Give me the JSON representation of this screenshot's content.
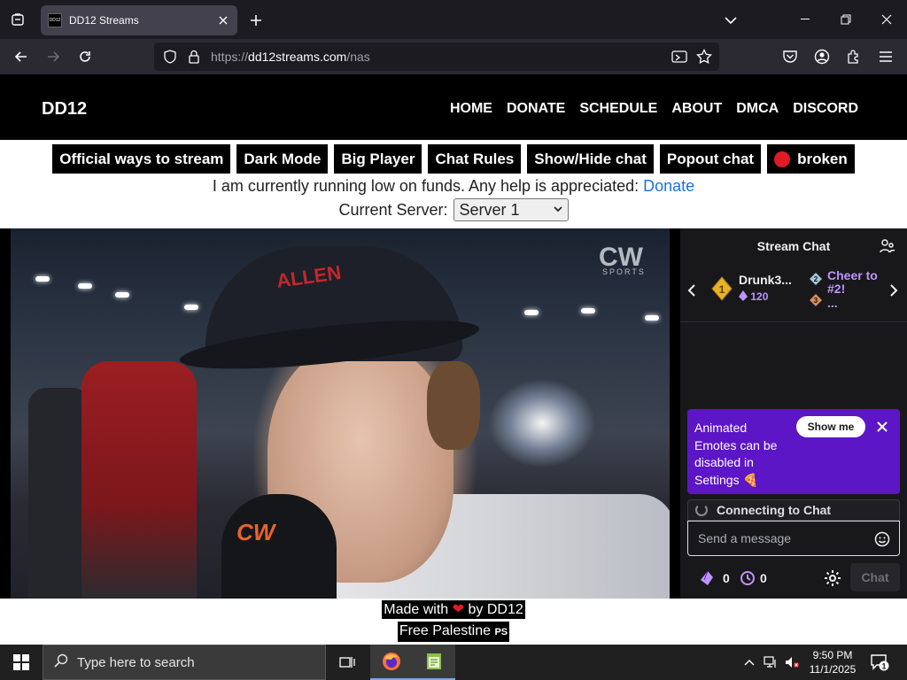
{
  "browser": {
    "tab_title": "DD12 Streams",
    "favicon_text": "DD12",
    "url_prefix": "https://",
    "url_domain": "dd12streams.com",
    "url_path": "/nas"
  },
  "site": {
    "logo": "DD12",
    "nav": [
      "HOME",
      "DONATE",
      "SCHEDULE",
      "ABOUT",
      "DMCA",
      "DISCORD"
    ]
  },
  "controls": {
    "buttons": [
      "Official ways to stream",
      "Dark Mode",
      "Big Player",
      "Chat Rules",
      "Show/Hide chat",
      "Popout chat"
    ],
    "status_button": "broken",
    "status_color": "#e01b24"
  },
  "funds": {
    "message": "I am currently running low on funds. Any help is appreciated:",
    "link": "Donate"
  },
  "server": {
    "label": "Current Server:",
    "selected": "Server 1"
  },
  "video": {
    "cap_text": "ALLEN",
    "network_logo": "CW",
    "network_sub": "SPORTS",
    "mic_text": "CW"
  },
  "chat": {
    "title": "Stream Chat",
    "leader_name": "Drunk3...",
    "leader_points": "120",
    "leader_rank": "1",
    "cheer_label": "Cheer to #2!",
    "cheer_more": "...",
    "rank2": "2",
    "rank3": "3",
    "emote_message": "Animated Emotes can be disabled in Settings",
    "emote_button": "Show me",
    "connecting": "Connecting to Chat",
    "input_placeholder": "Send a message",
    "bits_count": "0",
    "points_count": "0",
    "send_button": "Chat",
    "accent": "#5c16c5"
  },
  "footer": {
    "made_with_prefix": "Made with",
    "made_with_suffix": "by DD12",
    "palestine": "Free Palestine",
    "flag": "PS"
  },
  "taskbar": {
    "search_placeholder": "Type here to search",
    "time": "9:50 PM",
    "date": "11/1/2025",
    "notification_count": "1"
  }
}
